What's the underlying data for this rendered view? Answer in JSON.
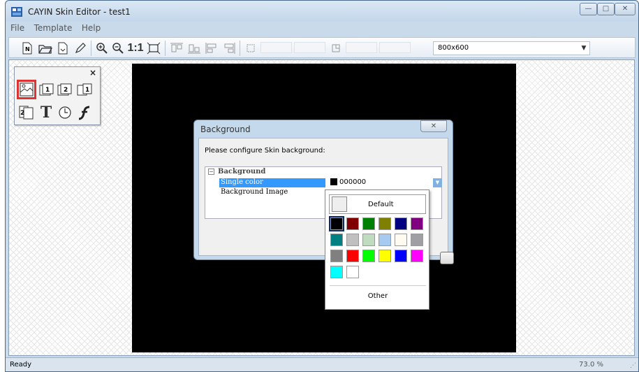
{
  "window": {
    "title": "CAYIN Skin Editor - test1",
    "minimize_label": "—",
    "maximize_label": "□",
    "close_label": "✕"
  },
  "menu": [
    "File",
    "Template",
    "Help"
  ],
  "toolbar": {
    "zoom_100_label": "1:1",
    "resolution": "800x600"
  },
  "palette": {
    "close_label": "×",
    "tools": [
      "background-tool",
      "region1-tool",
      "region2-tool",
      "video-tool",
      "region-tool",
      "text-tool",
      "clock-tool",
      "flash-tool"
    ]
  },
  "dialog": {
    "title": "Background",
    "prompt": "Please configure Skin background:",
    "close_label": "✕",
    "group_label": "Background",
    "group_toggle": "−",
    "properties": [
      {
        "label": "Single color",
        "value": "000000"
      },
      {
        "label": "Background Image",
        "value": ""
      }
    ]
  },
  "color_popup": {
    "default_label": "Default",
    "other_label": "Other",
    "colors": [
      "#000000",
      "#800000",
      "#008000",
      "#808000",
      "#000080",
      "#800080",
      "#008080",
      "#c0c0c0",
      "#c0dcc0",
      "#a6caf0",
      "#fffbf0",
      "#a0a0a4",
      "#808080",
      "#ff0000",
      "#00ff00",
      "#ffff00",
      "#0000ff",
      "#ff00ff",
      "#00ffff",
      "#ffffff"
    ],
    "selected_index": 0
  },
  "statusbar": {
    "status": "Ready",
    "zoom": "73.0 %",
    "grip": "⋰"
  }
}
